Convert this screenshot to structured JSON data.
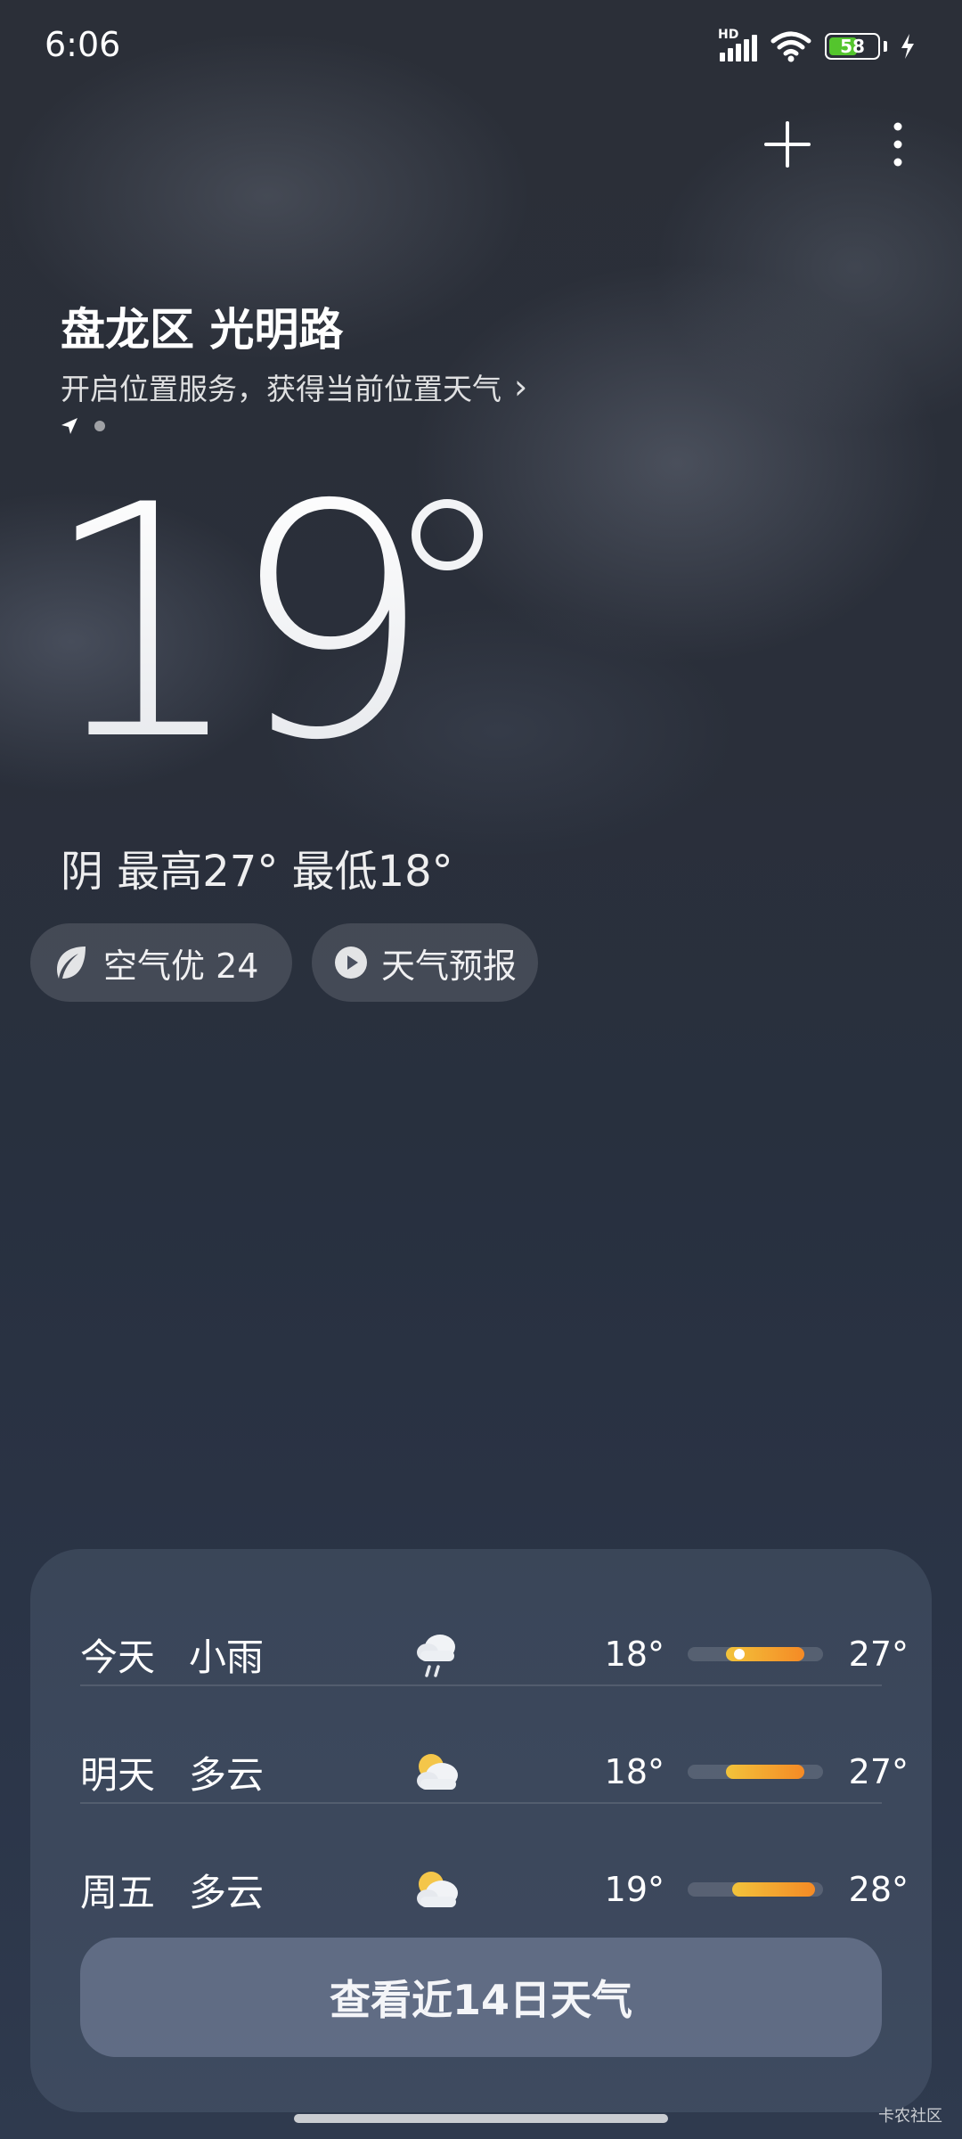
{
  "status_bar": {
    "time": "6:06",
    "hd_label": "HD",
    "battery_level": "58",
    "icons": [
      "hd-signal-icon",
      "wifi-icon",
      "battery-icon",
      "charging-icon"
    ]
  },
  "top_actions": {
    "add_icon": "plus-icon",
    "more_icon": "more-vertical-icon"
  },
  "location": {
    "title": "盘龙区 光明路",
    "hint": "开启位置服务，获得当前位置天气",
    "hint_arrow": "›"
  },
  "current": {
    "temperature": "19",
    "summary": "阴  最高27° 最低18°"
  },
  "chips": {
    "aqi": "空气优 24",
    "forecast": "天气预报"
  },
  "forecast": {
    "rows": [
      {
        "day": "今天",
        "condition": "小雨",
        "icon": "light-rain-icon",
        "low": "18°",
        "high": "27°",
        "bar_start": 0.28,
        "bar_end": 0.86,
        "now": 0.38
      },
      {
        "day": "明天",
        "condition": "多云",
        "icon": "partly-cloudy-icon",
        "low": "18°",
        "high": "27°",
        "bar_start": 0.28,
        "bar_end": 0.86
      },
      {
        "day": "周五",
        "condition": "多云",
        "icon": "partly-cloudy-icon",
        "low": "19°",
        "high": "28°",
        "bar_start": 0.33,
        "bar_end": 0.94
      }
    ],
    "cta_label": "查看近14日天气"
  },
  "watermark": "卡农社区",
  "colors": {
    "accent_orange": "#f58a25",
    "accent_yellow": "#f2c33b",
    "battery_green": "#54c52d"
  }
}
